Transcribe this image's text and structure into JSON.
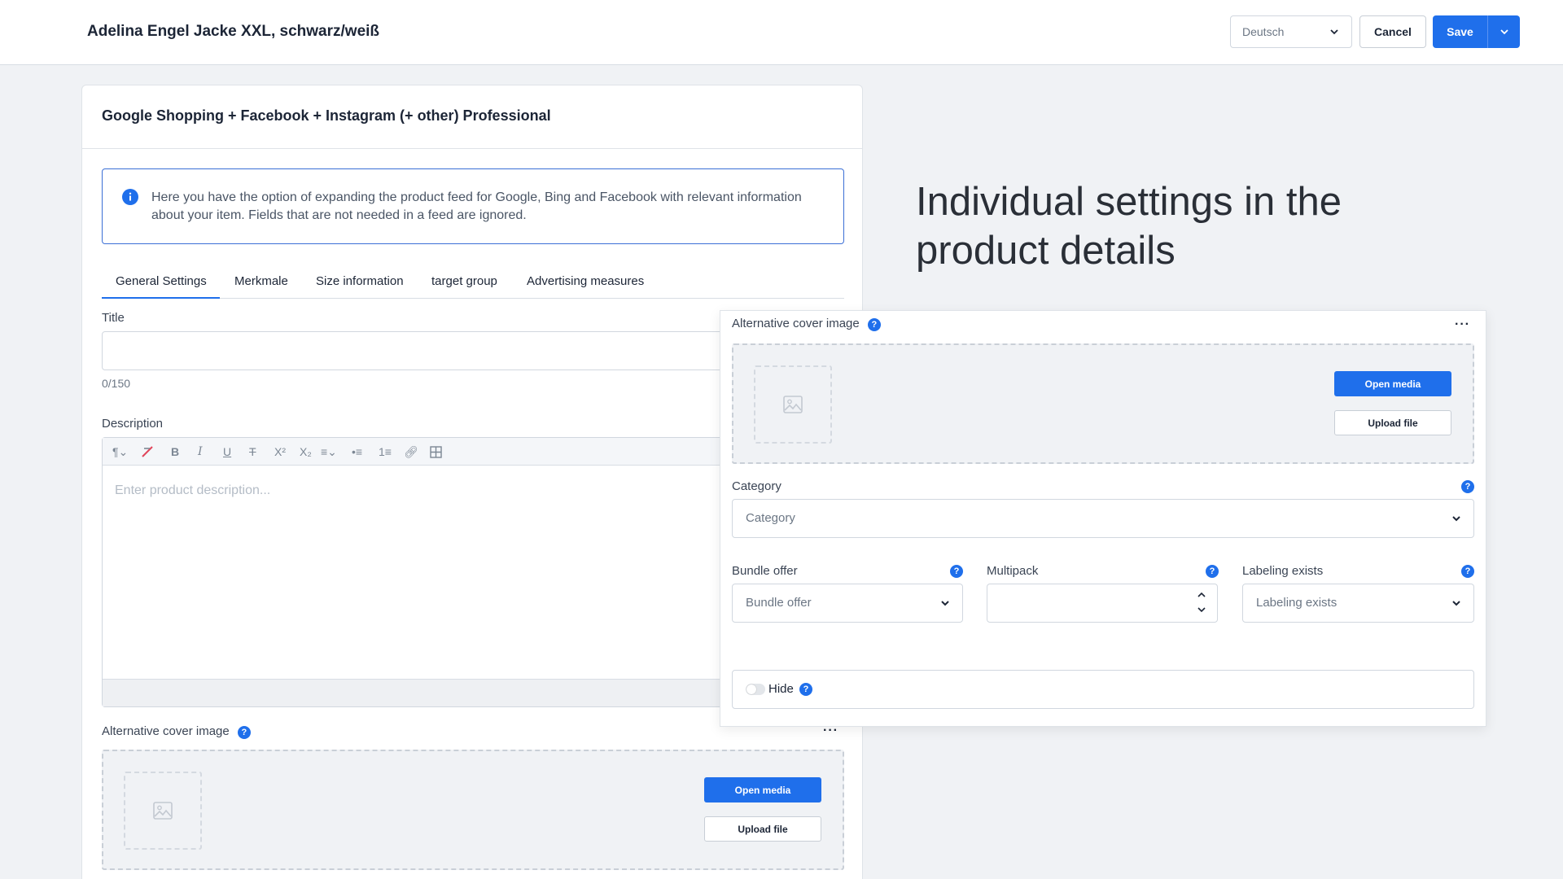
{
  "header": {
    "product_title": "Adelina Engel Jacke XXL, schwarz/weiß",
    "language": "Deutsch",
    "cancel_label": "Cancel",
    "save_label": "Save"
  },
  "card": {
    "title": "Google Shopping + Facebook + Instagram (+ other) Professional",
    "info_text": "Here you have the option of expanding the product feed for Google, Bing and Facebook with relevant information about your item. Fields that are not needed in a feed are ignored.",
    "tabs": [
      {
        "label": "General Settings"
      },
      {
        "label": "Merkmale"
      },
      {
        "label": "Size information"
      },
      {
        "label": "target group"
      },
      {
        "label": "Advertising measures"
      }
    ],
    "title_label": "Title",
    "title_counter": "0/150",
    "description_label": "Description",
    "description_placeholder": "Enter product description...",
    "cover_label": "Alternative cover image",
    "open_media_label": "Open media",
    "upload_file_label": "Upload file"
  },
  "heading": "Individual settings in the product details",
  "overlay": {
    "cover_label": "Alternative cover image",
    "open_media_label": "Open media",
    "upload_file_label": "Upload file",
    "category_label": "Category",
    "category_placeholder": "Category",
    "bundle_label": "Bundle offer",
    "bundle_placeholder": "Bundle offer",
    "multipack_label": "Multipack",
    "labeling_label": "Labeling exists",
    "labeling_placeholder": "Labeling exists",
    "hide_label": "Hide"
  },
  "help_glyph": "?",
  "colors": {
    "accent": "#1f6feb",
    "info_border": "#3b6fd6"
  }
}
